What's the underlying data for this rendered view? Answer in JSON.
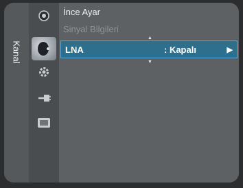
{
  "sidebar": {
    "section_label": "Kanal",
    "icons": [
      {
        "name": "picture-icon"
      },
      {
        "name": "channel-icon"
      },
      {
        "name": "setup-icon"
      },
      {
        "name": "input-icon"
      },
      {
        "name": "application-icon"
      }
    ]
  },
  "menu": {
    "items": [
      {
        "label": "İnce Ayar",
        "enabled": true
      },
      {
        "label": "Sinyal Bilgileri",
        "enabled": false
      }
    ],
    "selected": {
      "label": "LNA",
      "value": ": Kapalı",
      "arrow": "▶"
    },
    "scroll_up": "▲",
    "scroll_down": "▼"
  },
  "colors": {
    "highlight": "#2f6f8e",
    "highlight_border": "#5aa8cf",
    "panel": "#55585b",
    "disabled_text": "#8f9397"
  }
}
